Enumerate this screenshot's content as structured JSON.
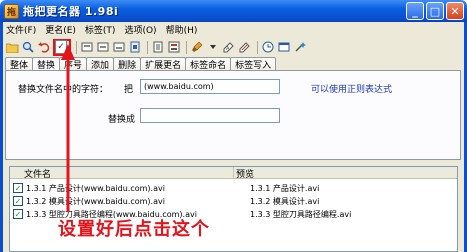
{
  "window": {
    "title": "拖把更名器 1.98i",
    "app_icon_glyph": "拖",
    "controls": {
      "minimize": "_",
      "maximize": "□",
      "close": "✕"
    }
  },
  "menu": [
    "文件(F)",
    "更名(E)",
    "标签(T)",
    "选项(O)",
    "帮助(H)"
  ],
  "toolbar": {
    "icons": [
      "open-folder-icon",
      "search-icon",
      "undo-icon",
      "check-icon",
      "tag-icon",
      "tag-icon",
      "tag-icon",
      "page-icon",
      "page-icon",
      "list-icon",
      "brush-icon",
      "tag-edit-icon",
      "tag-edit-icon",
      "clock-icon",
      "window-icon",
      "wand-icon"
    ],
    "highlighted": "check-icon",
    "check_glyph": "✓"
  },
  "tabs": [
    "整体",
    "替换",
    "序号",
    "添加",
    "删除",
    "扩展更名",
    "标签命名",
    "标签写入"
  ],
  "active_tab": "替换",
  "replace": {
    "find_label": "替换文件名中的字符：",
    "find_prefix": "把",
    "find_value": "(www.baidu.com)",
    "hint": "可以使用正则表达式",
    "replace_label": "替换成",
    "replace_value": ""
  },
  "file_list": {
    "columns": [
      "文件名",
      "预览"
    ],
    "rows": [
      {
        "name": "1.3.1 产品设计(www.baidu.com).avi",
        "preview": "1.3.1 产品设计.avi",
        "checked": true
      },
      {
        "name": "1.3.2 模具设计(www.baidu.com).avi",
        "preview": "1.3.2 模具设计.avi",
        "checked": true
      },
      {
        "name": "1.3.3 型腔刀具路径编程(www.baidu.com).avi",
        "preview": "1.3.3 型腔刀具路径编程.avi",
        "checked": true
      }
    ]
  },
  "annotation": {
    "text": "设置好后点击这个",
    "color": "#e2141c"
  }
}
